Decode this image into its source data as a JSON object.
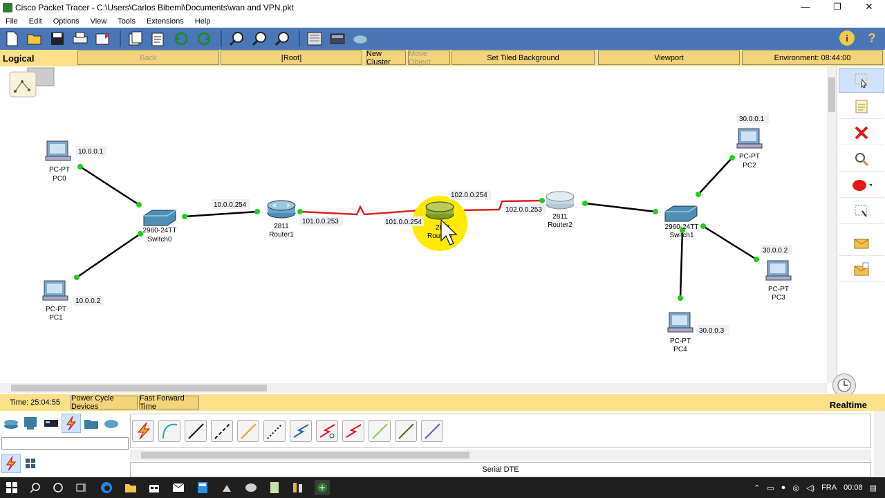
{
  "window": {
    "title": "Cisco Packet Tracer - C:\\Users\\Carlos Bibemi\\Documents\\wan and VPN.pkt",
    "controls": [
      "—",
      "❐",
      "✕"
    ]
  },
  "menu": [
    "File",
    "Edit",
    "Options",
    "View",
    "Tools",
    "Extensions",
    "Help"
  ],
  "navbar": {
    "mode": "Logical",
    "back": "Back",
    "root": "[Root]",
    "new_cluster": "New Cluster",
    "move_object": "Move Object",
    "tiled_bg": "Set Tiled Background",
    "viewport": "Viewport",
    "environment": "Environment: 08:44:00"
  },
  "devices": {
    "pc0": {
      "model": "PC-PT",
      "name": "PC0",
      "ip": "10.0.0.1"
    },
    "pc1": {
      "model": "PC-PT",
      "name": "PC1",
      "ip": "10.0.0.2"
    },
    "switch0": {
      "model": "2960-24TT",
      "name": "Switch0"
    },
    "router1": {
      "model": "2811",
      "name": "Router1",
      "lan_ip": "10.0.0.254",
      "wan_ip": "101.0.0.253"
    },
    "router0": {
      "model": "2811",
      "name": "Router0",
      "wan1_ip": "101.0.0.254",
      "wan2_ip": "102.0.0.254"
    },
    "router2": {
      "model": "2811",
      "name": "Router2",
      "wan_ip": "102.0.0.253"
    },
    "switch1": {
      "model": "2960-24TT",
      "name": "Switch1"
    },
    "pc2": {
      "model": "PC-PT",
      "name": "PC2",
      "ip": "30.0.0.1"
    },
    "pc3": {
      "model": "PC-PT",
      "name": "PC3",
      "ip": "30.0.0.2"
    },
    "pc4": {
      "model": "PC-PT",
      "name": "PC4",
      "ip": "30.0.0.3"
    }
  },
  "status": {
    "time": "Time: 25:04:55",
    "power_cycle": "Power Cycle Devices",
    "fast_forward": "Fast Forward Time",
    "mode": "Realtime"
  },
  "cable_selected": "Serial DTE",
  "tray": {
    "lang": "FRA",
    "clock": "00:08"
  },
  "colors": {
    "toolbar": "#4a76b8",
    "navbar": "#fbe08a",
    "serial": "#e02020",
    "link_dot": "#22cc22",
    "highlight": "#ffea00"
  }
}
